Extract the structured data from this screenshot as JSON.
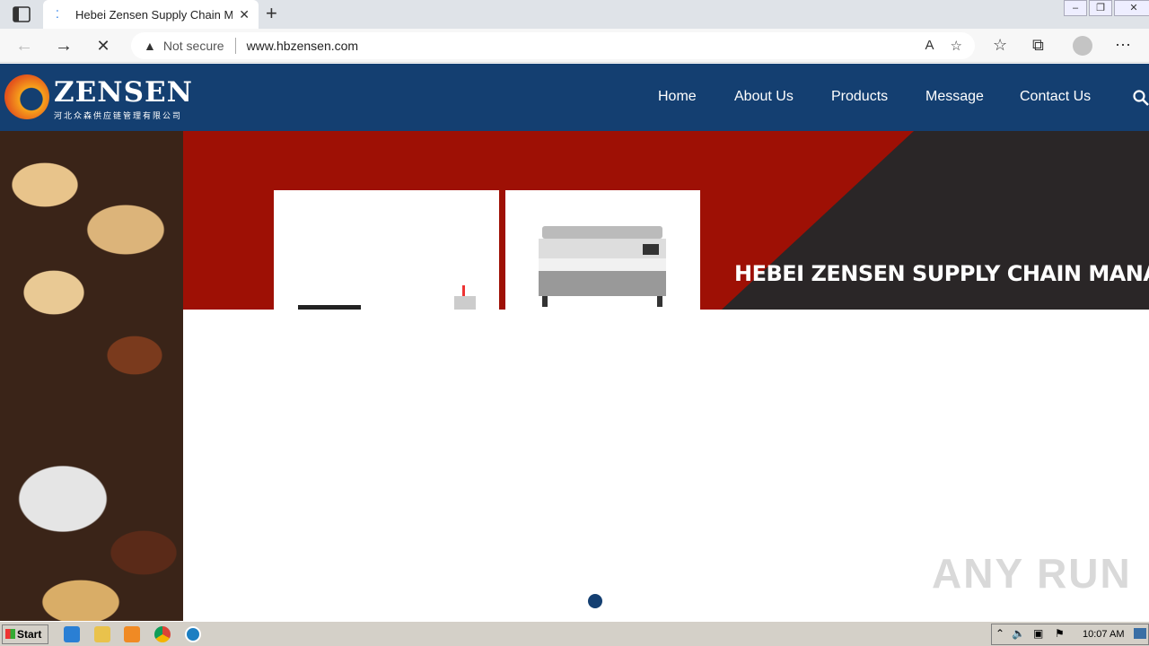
{
  "browser": {
    "tab_title": "Hebei Zensen Supply Chain Man",
    "not_secure": "Not secure",
    "url": "www.hbzensen.com"
  },
  "site": {
    "logo_text": "ZENSEN",
    "logo_sub": "河北众森供应链管理有限公司",
    "nav": [
      "Home",
      "About Us",
      "Products",
      "Message",
      "Contact Us"
    ]
  },
  "hero": {
    "title": "HEBEI ZENSEN SUPPLY CHAIN MANAGEME"
  },
  "watermark": "ANY RUN",
  "taskbar": {
    "start": "Start",
    "clock": "10:07 AM"
  }
}
